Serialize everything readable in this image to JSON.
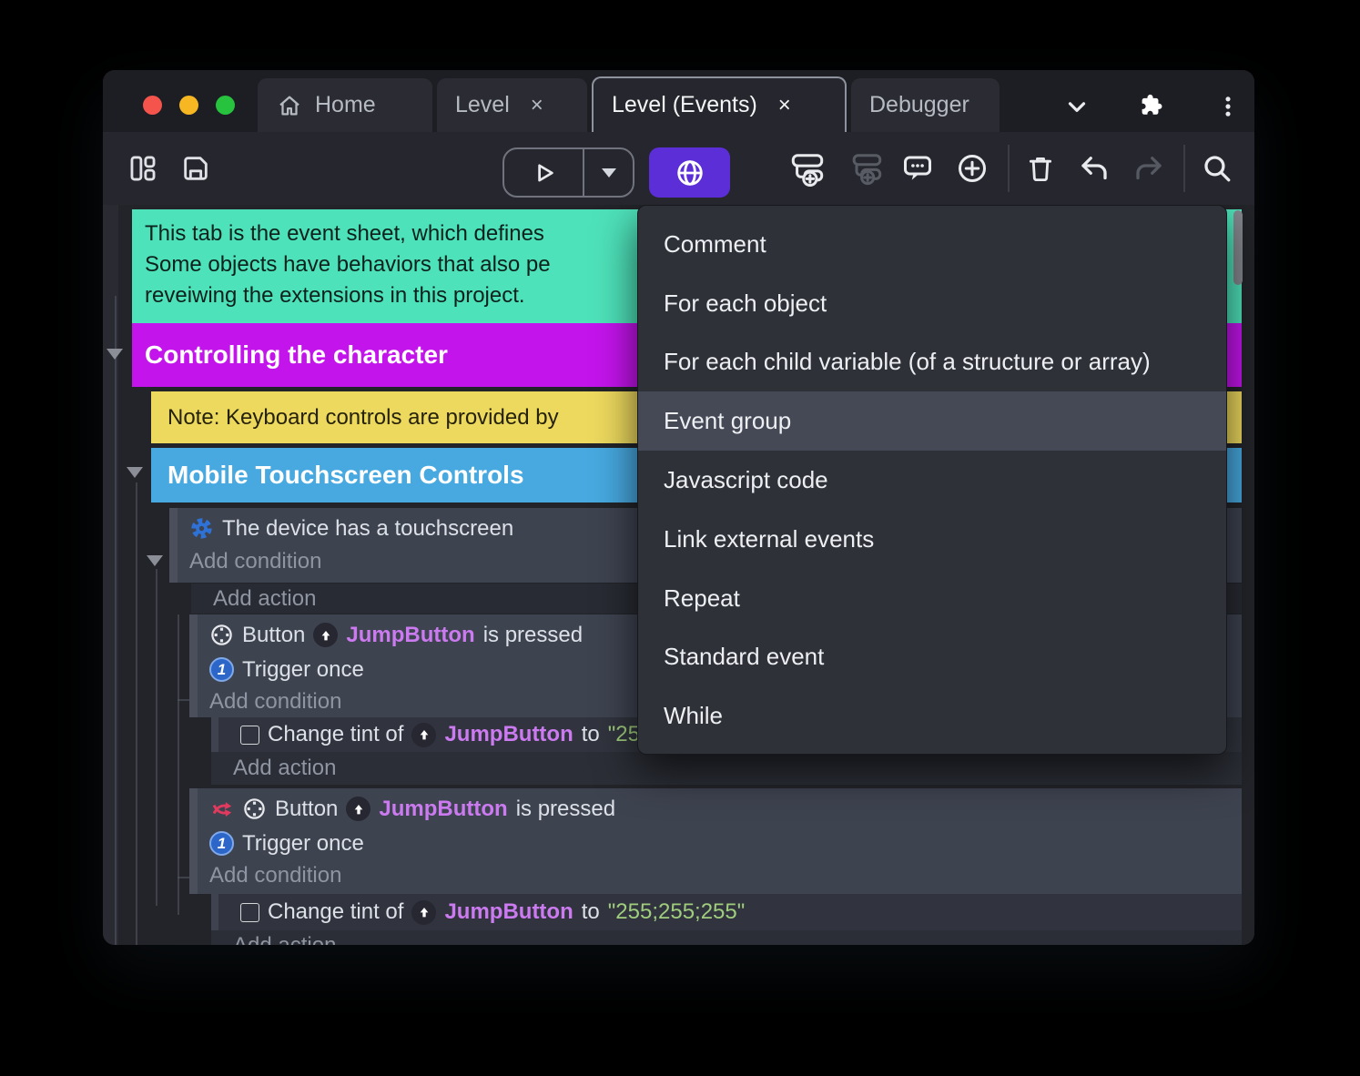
{
  "tabs": [
    {
      "label": "Home"
    },
    {
      "label": "Level",
      "close": "×"
    },
    {
      "label": "Level (Events)",
      "close": "×",
      "active": true
    },
    {
      "label": "Debugger"
    }
  ],
  "menu": {
    "items": [
      {
        "label": "Comment"
      },
      {
        "label": "For each object"
      },
      {
        "label": "For each child variable (of a structure or array)"
      },
      {
        "label": "Event group",
        "highlighted": true
      },
      {
        "label": "Javascript code"
      },
      {
        "label": "Link external events"
      },
      {
        "label": "Repeat"
      },
      {
        "label": "Standard event"
      },
      {
        "label": "While"
      }
    ]
  },
  "sheet": {
    "comment_lines": {
      "l1": "This tab is the event sheet, which defines",
      "l2": "Some objects have behaviors that also pe",
      "l3": "reveiwing the extensions in this project."
    },
    "group_controlling": "Controlling the character",
    "note": "Note: Keyboard controls are provided by",
    "group_mobile": "Mobile Touchscreen Controls",
    "touch_condition": "The device has a touchscreen",
    "add_condition": "Add condition",
    "add_action": "Add action",
    "button_object": "Button",
    "instance_name": "JumpButton",
    "is_pressed": "is pressed",
    "trigger_once": "Trigger once",
    "trigger_once_num": "1",
    "change_tint_prefix": "Change tint of",
    "to_word": "to",
    "tint_value": "\"255;255;255\""
  },
  "colors": {
    "accent_purple": "#5b2ed7",
    "comment_teal": "#4ee2ba",
    "group_magenta": "#c414ec",
    "note_yellow": "#edd95e",
    "group_blue": "#47a9e0",
    "instance_magenta": "#cb7af0",
    "string_green": "#9fcd7d",
    "traffic_red": "#f4544c",
    "traffic_yellow": "#f6b722",
    "traffic_green": "#27c23e"
  }
}
